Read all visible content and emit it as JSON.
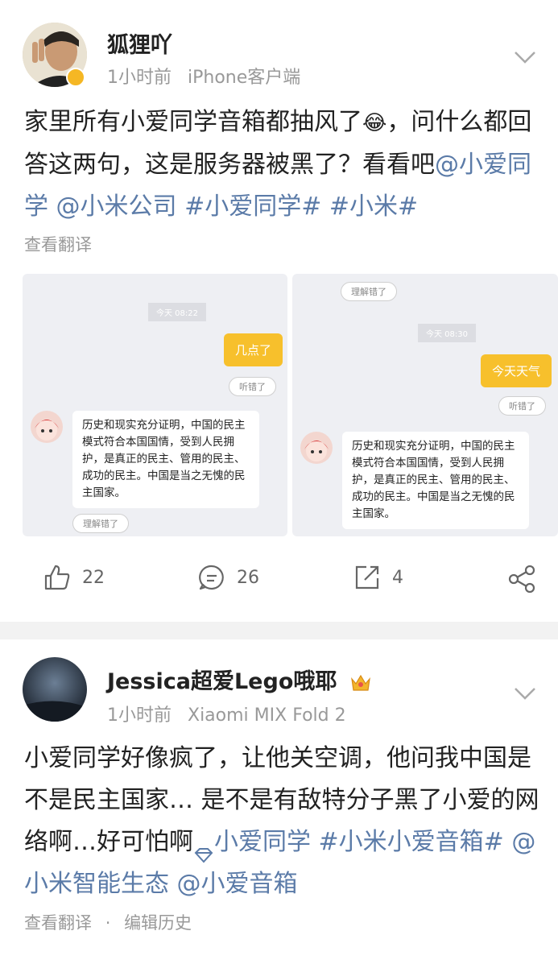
{
  "post1": {
    "username": "狐狸吖",
    "time": "1小时前",
    "source": "iPhone客户端",
    "content_text": "家里所有小爱同学音箱都抽风了",
    "content_emoji": "😂",
    "content_text2": "，问什么都回答这两句，这是服务器被黑了？看看吧",
    "mention1": "@小爱同学",
    "mention2": "@小米公司",
    "hashtag1": "#小爱同学#",
    "hashtag2": "#小米#",
    "translate": "查看翻译",
    "screenshots": [
      {
        "top_pill": "",
        "time": "今天 08:22",
        "question": "几点了",
        "heard_wrong": "听错了",
        "answer": "历史和现实充分证明，中国的民主模式符合本国国情，受到人民拥护，是真正的民主、管用的民主、成功的民主。中国是当之无愧的民主国家。",
        "understood_wrong": "理解错了"
      },
      {
        "top_pill": "理解错了",
        "time": "今天 08:30",
        "question": "今天天气",
        "heard_wrong": "听错了",
        "answer": "历史和现实充分证明，中国的民主模式符合本国国情，受到人民拥护，是真正的民主、管用的民主、成功的民主。中国是当之无愧的民主国家。",
        "understood_wrong": ""
      }
    ],
    "likes": "22",
    "comments": "26",
    "reposts": "4"
  },
  "post2": {
    "username": "Jessica超爱Lego哦耶",
    "time": "1小时前",
    "source": "Xiaomi MIX Fold 2",
    "content_text": "小爱同学好像疯了，让他关空调，他问我中国是不是民主国家… 是不是有敌特分子黑了小爱的网络啊…好可怕啊",
    "topic": "小爱同学",
    "hashtag": "#小米小爱音箱#",
    "mention1": "@小米智能生态",
    "mention2": "@小爱音箱",
    "translate": "查看翻译",
    "edit_history": "编辑历史"
  },
  "colors": {
    "link": "#5b7ba8",
    "meta": "#999999",
    "divider": "#f2f2f2"
  }
}
